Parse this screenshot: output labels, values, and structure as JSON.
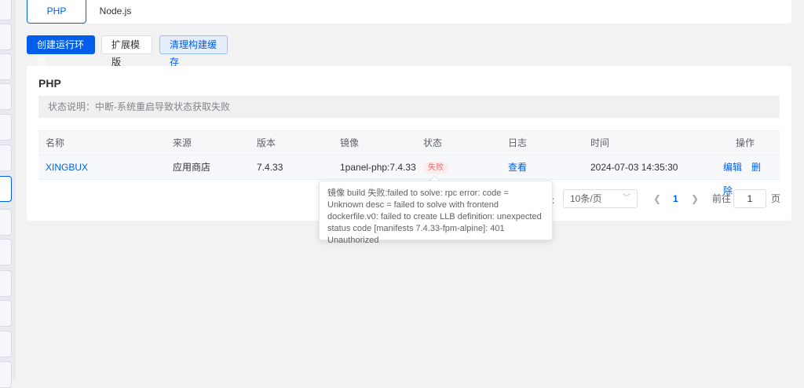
{
  "tabs": [
    {
      "label": "PHP",
      "active": true
    },
    {
      "label": "Node.js",
      "active": false
    }
  ],
  "actions": {
    "create": "创建运行环境",
    "ext_template": "扩展模版",
    "clear_cache": "清理构建缓存"
  },
  "card": {
    "title": "PHP",
    "status_note": "状态说明：中断-系统重启导致状态获取失败"
  },
  "table": {
    "headers": [
      "名称",
      "来源",
      "版本",
      "镜像",
      "状态",
      "日志",
      "时间",
      "操作"
    ],
    "rows": [
      {
        "name": "XINGBUX",
        "source": "应用商店",
        "version": "7.4.33",
        "image": "1panel-php:7.4.33",
        "status": "失败",
        "log": "查看",
        "time": "2024-07-03 14:35:30",
        "ops": [
          "编辑",
          "删除"
        ]
      }
    ]
  },
  "tooltip": {
    "text": "镜像 build 失败:failed to solve: rpc error: code = Unknown desc = failed to solve with frontend dockerfile.v0: failed to create LLB definition: unexpected status code [manifests 7.4.33-fpm-alpine]: 401 Unauthorized"
  },
  "pagination": {
    "partial_label": ":",
    "page_size": "10条/页",
    "current_page": "1",
    "goto_prefix": "前往",
    "goto_value": "1",
    "goto_suffix": "页"
  },
  "colors": {
    "primary": "#005eeb",
    "danger": "#f56c6c",
    "background": "#f2f2f2"
  }
}
